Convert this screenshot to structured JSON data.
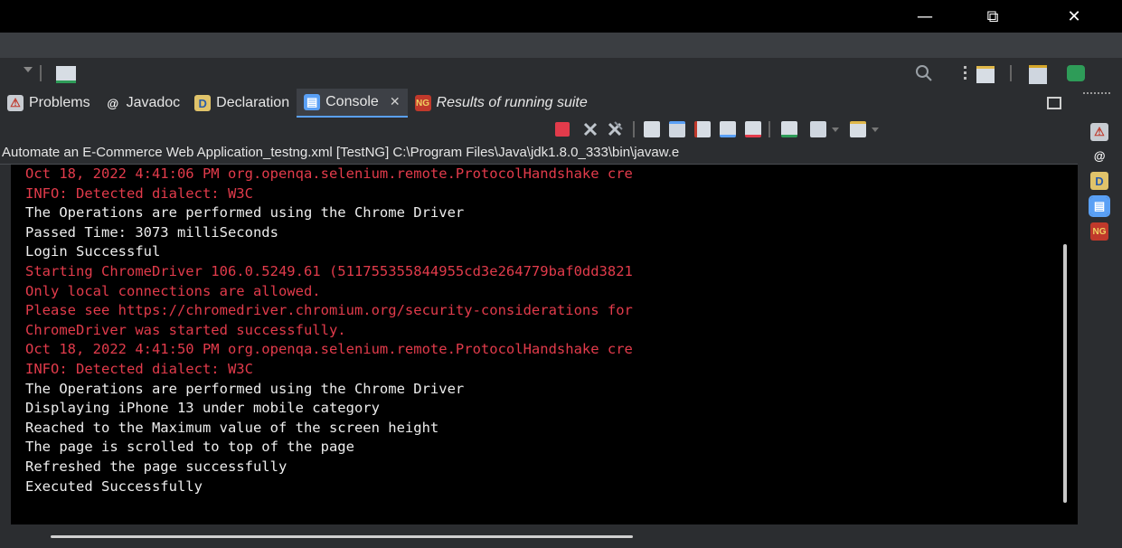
{
  "window": {
    "minimize_glyph": "—",
    "restore_glyph": "⧉",
    "close_glyph": "✕"
  },
  "toolbar": {
    "icons": [
      "perspective-icon",
      "search-icon",
      "open-perspective-icon",
      "java-perspective-icon",
      "debug-perspective-icon"
    ]
  },
  "tabs": [
    {
      "label": "Problems",
      "icon": "problems-icon",
      "glyph": "⚠",
      "active": false
    },
    {
      "label": "Javadoc",
      "icon": "javadoc-icon",
      "glyph": "@",
      "active": false
    },
    {
      "label": "Declaration",
      "icon": "declaration-icon",
      "glyph": "D",
      "active": false
    },
    {
      "label": "Console",
      "icon": "console-icon",
      "glyph": "▤",
      "active": true,
      "close_glyph": "✕"
    },
    {
      "label": "Results of running suite",
      "icon": "testng-icon",
      "glyph": "NG",
      "active": false
    }
  ],
  "console_tools": [
    "terminate-icon",
    "remove-launch-icon",
    "remove-all-launches-icon",
    "clear-console-icon",
    "scroll-lock-icon",
    "word-wrap-icon",
    "show-on-stdout-icon",
    "show-on-stderr-icon",
    "pin-console-icon",
    "display-selected-console-icon",
    "open-console-icon"
  ],
  "launch_title": "Automate an E-Commerce Web Application_testng.xml [TestNG] C:\\Program Files\\Java\\jdk1.8.0_333\\bin\\javaw.e",
  "console_lines": [
    {
      "text": "Oct 18, 2022 4:41:06 PM org.openqa.selenium.remote.ProtocolHandshake cre",
      "stream": "err"
    },
    {
      "text": "INFO: Detected dialect: W3C",
      "stream": "err"
    },
    {
      "text": "The Operations are performed using the Chrome Driver",
      "stream": "out"
    },
    {
      "text": "Passed Time: 3073 milliSeconds",
      "stream": "out"
    },
    {
      "text": "Login Successful",
      "stream": "out"
    },
    {
      "text": "Starting ChromeDriver 106.0.5249.61 (511755355844955cd3e264779baf0dd3821",
      "stream": "err"
    },
    {
      "text": "Only local connections are allowed.",
      "stream": "err"
    },
    {
      "text": "Please see https://chromedriver.chromium.org/security-considerations for",
      "stream": "err"
    },
    {
      "text": "ChromeDriver was started successfully.",
      "stream": "err"
    },
    {
      "text": "Oct 18, 2022 4:41:50 PM org.openqa.selenium.remote.ProtocolHandshake cre",
      "stream": "err"
    },
    {
      "text": "INFO: Detected dialect: W3C",
      "stream": "err"
    },
    {
      "text": "The Operations are performed using the Chrome Driver",
      "stream": "out"
    },
    {
      "text": "Displaying iPhone 13 under mobile category",
      "stream": "out"
    },
    {
      "text": "Reached to the Maximum value of the screen height",
      "stream": "out"
    },
    {
      "text": "The page is scrolled to top of the page",
      "stream": "out"
    },
    {
      "text": "Refreshed the page successfully",
      "stream": "out"
    },
    {
      "text": "Executed Successfully",
      "stream": "out"
    }
  ],
  "colors": {
    "stderr": "#e23b4b",
    "stdout": "#ededed",
    "console_bg": "#000000",
    "panel_bg": "#2b2d30",
    "accent": "#5aa0f5"
  },
  "sidebar": {
    "icons": [
      "problems-icon",
      "javadoc-icon",
      "declaration-icon",
      "console-icon",
      "testng-icon"
    ]
  }
}
